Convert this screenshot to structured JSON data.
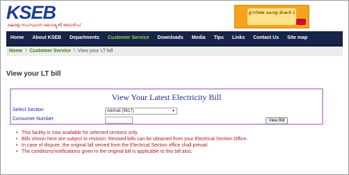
{
  "header": {
    "logo_text": "KSEB",
    "logo_tagline": "കേരള സംസ്ഥാന വൈദ്യുതി ബോർഡ്",
    "banner_text": "ഊർജ്ജ കേരള മിഷൻ 2"
  },
  "nav": {
    "items": [
      {
        "label": "Home"
      },
      {
        "label": "About KSEB"
      },
      {
        "label": "Departments"
      },
      {
        "label": "Customer Service"
      },
      {
        "label": "Downloads"
      },
      {
        "label": "Media"
      },
      {
        "label": "Tips"
      },
      {
        "label": "Links"
      },
      {
        "label": "Contact Us"
      },
      {
        "label": "Site map"
      }
    ],
    "active_index": 3
  },
  "breadcrumb": {
    "home": "Home",
    "sep": "\\",
    "section": "Customer Service",
    "current": "View your LT bill"
  },
  "page": {
    "title": "View your LT bill"
  },
  "form": {
    "heading": "View Your Latest Electricity Bill",
    "section_label": "Select Section",
    "section_value": "Adimali (5617)",
    "consumer_label": "Consumer Number",
    "consumer_value": "",
    "button_label": "View Bill"
  },
  "notes": [
    "This facility is now available for selected sections only.",
    "Bills shown here are subject to revision. Revised bills can be obtained from your Electrical Section Office.",
    "In case of dispute, the original bill served from the Electrical Section office shall prevail.",
    "The conditions/notifications given in the original bill is applicable to this bill also."
  ],
  "colors": {
    "nav_bg": "#16244a",
    "nav_active": "#8bdc4e",
    "form_border": "#c9a2dc",
    "heading_blue": "#1d2aa8",
    "note_red": "#b01c1c",
    "crumb_green": "#3c7d12"
  }
}
